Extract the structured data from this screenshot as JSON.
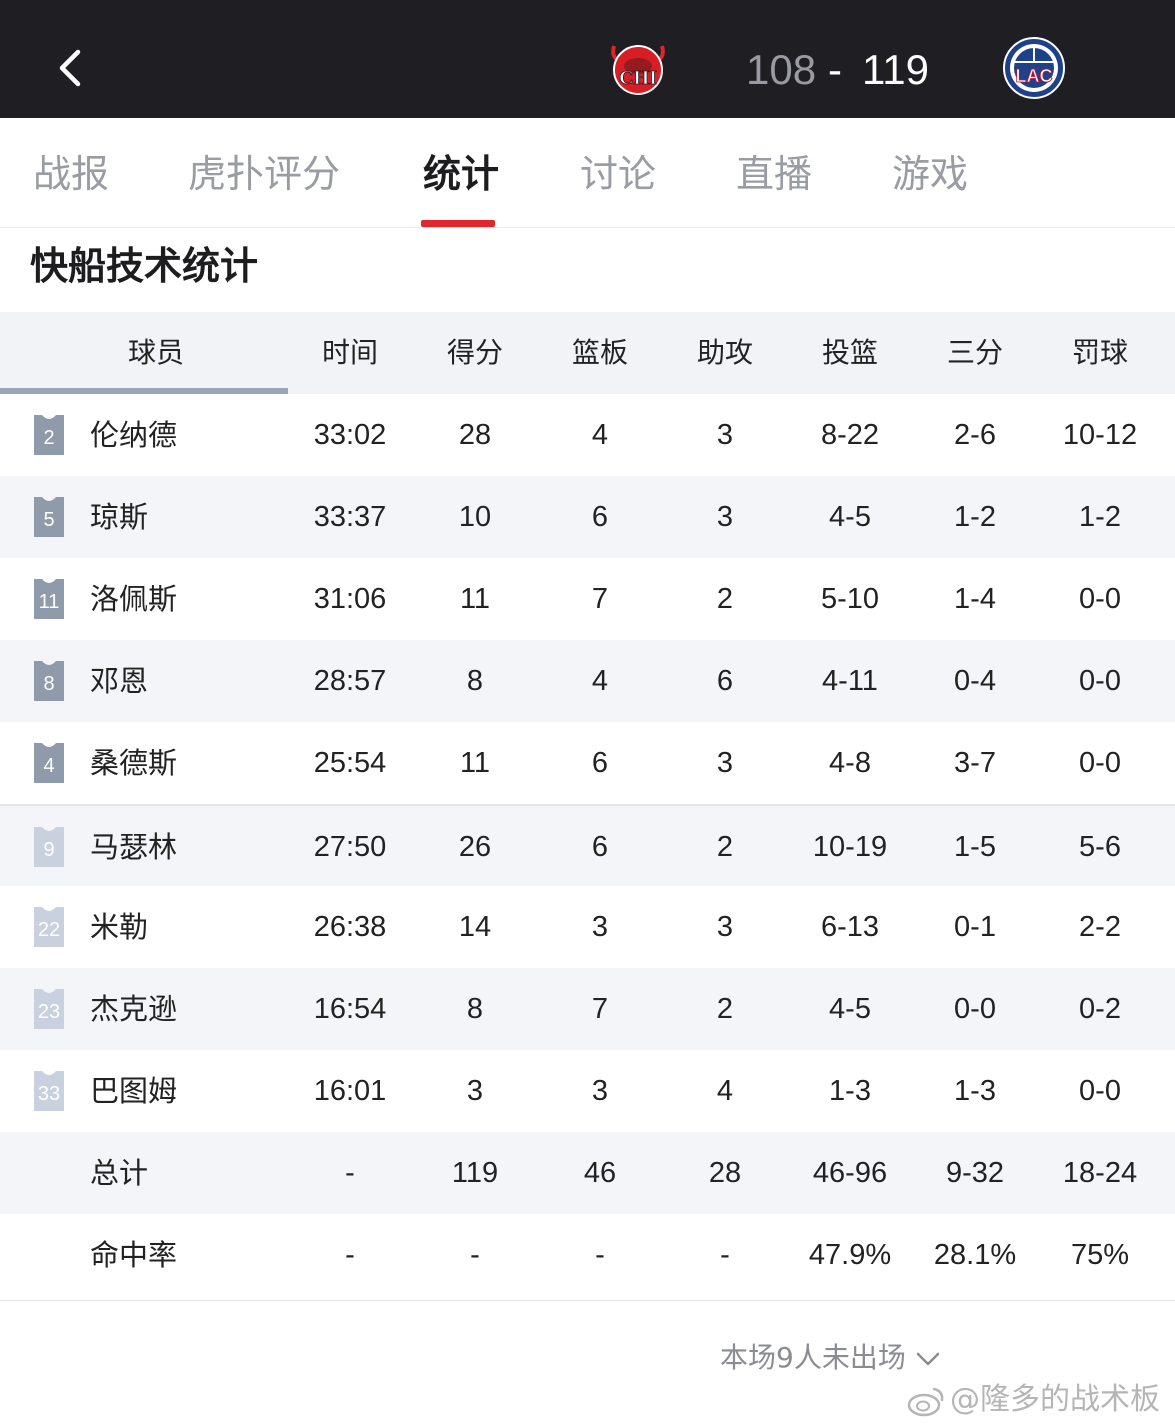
{
  "header": {
    "home_team_logo_text": "CHI",
    "away_team_logo_text": "LAC",
    "home_score": "108",
    "score_separator": "-",
    "away_score": "119",
    "colors": {
      "background": "#1f1f23",
      "home_score": "#9a9aa2",
      "away_score": "#ffffff"
    }
  },
  "tabs": [
    {
      "label": "战报",
      "active": false
    },
    {
      "label": "虎扑评分",
      "active": false
    },
    {
      "label": "统计",
      "active": true
    },
    {
      "label": "讨论",
      "active": false
    },
    {
      "label": "直播",
      "active": false
    },
    {
      "label": "游戏",
      "active": false
    }
  ],
  "accent_color": "#e3262c",
  "section_title": "快船技术统计",
  "table": {
    "columns": [
      "球员",
      "时间",
      "得分",
      "篮板",
      "助攻",
      "投篮",
      "三分",
      "罚球"
    ],
    "starters": [
      {
        "number": "2",
        "name": "伦纳德",
        "min": "33:02",
        "pts": "28",
        "reb": "4",
        "ast": "3",
        "fg": "8-22",
        "tp": "2-6",
        "ft": "10-12"
      },
      {
        "number": "5",
        "name": "琼斯",
        "min": "33:37",
        "pts": "10",
        "reb": "6",
        "ast": "3",
        "fg": "4-5",
        "tp": "1-2",
        "ft": "1-2"
      },
      {
        "number": "11",
        "name": "洛佩斯",
        "min": "31:06",
        "pts": "11",
        "reb": "7",
        "ast": "2",
        "fg": "5-10",
        "tp": "1-4",
        "ft": "0-0"
      },
      {
        "number": "8",
        "name": "邓恩",
        "min": "28:57",
        "pts": "8",
        "reb": "4",
        "ast": "6",
        "fg": "4-11",
        "tp": "0-4",
        "ft": "0-0"
      },
      {
        "number": "4",
        "name": "桑德斯",
        "min": "25:54",
        "pts": "11",
        "reb": "6",
        "ast": "3",
        "fg": "4-8",
        "tp": "3-7",
        "ft": "0-0"
      }
    ],
    "bench": [
      {
        "number": "9",
        "name": "马瑟林",
        "min": "27:50",
        "pts": "26",
        "reb": "6",
        "ast": "2",
        "fg": "10-19",
        "tp": "1-5",
        "ft": "5-6"
      },
      {
        "number": "22",
        "name": "米勒",
        "min": "26:38",
        "pts": "14",
        "reb": "3",
        "ast": "3",
        "fg": "6-13",
        "tp": "0-1",
        "ft": "2-2"
      },
      {
        "number": "23",
        "name": "杰克逊",
        "min": "16:54",
        "pts": "8",
        "reb": "7",
        "ast": "2",
        "fg": "4-5",
        "tp": "0-0",
        "ft": "0-2"
      },
      {
        "number": "33",
        "name": "巴图姆",
        "min": "16:01",
        "pts": "3",
        "reb": "3",
        "ast": "4",
        "fg": "1-3",
        "tp": "1-3",
        "ft": "0-0"
      }
    ],
    "totals": {
      "label": "总计",
      "min": "-",
      "pts": "119",
      "reb": "46",
      "ast": "28",
      "fg": "46-96",
      "tp": "9-32",
      "ft": "18-24"
    },
    "percent": {
      "label": "命中率",
      "min": "-",
      "pts": "-",
      "reb": "-",
      "ast": "-",
      "fg": "47.9%",
      "tp": "28.1%",
      "ft": "75%"
    },
    "colors": {
      "starter_jersey": "#8f9aab",
      "bench_jersey": "#c9d0de",
      "header_bg": "#f2f3f6"
    }
  },
  "dnp_label": "本场9人未出场",
  "watermark": "@隆多的战术板",
  "icons": [
    "back-arrow-icon",
    "chi-logo-icon",
    "lac-logo-icon",
    "jersey-icon",
    "chevron-down-icon",
    "weibo-icon"
  ]
}
